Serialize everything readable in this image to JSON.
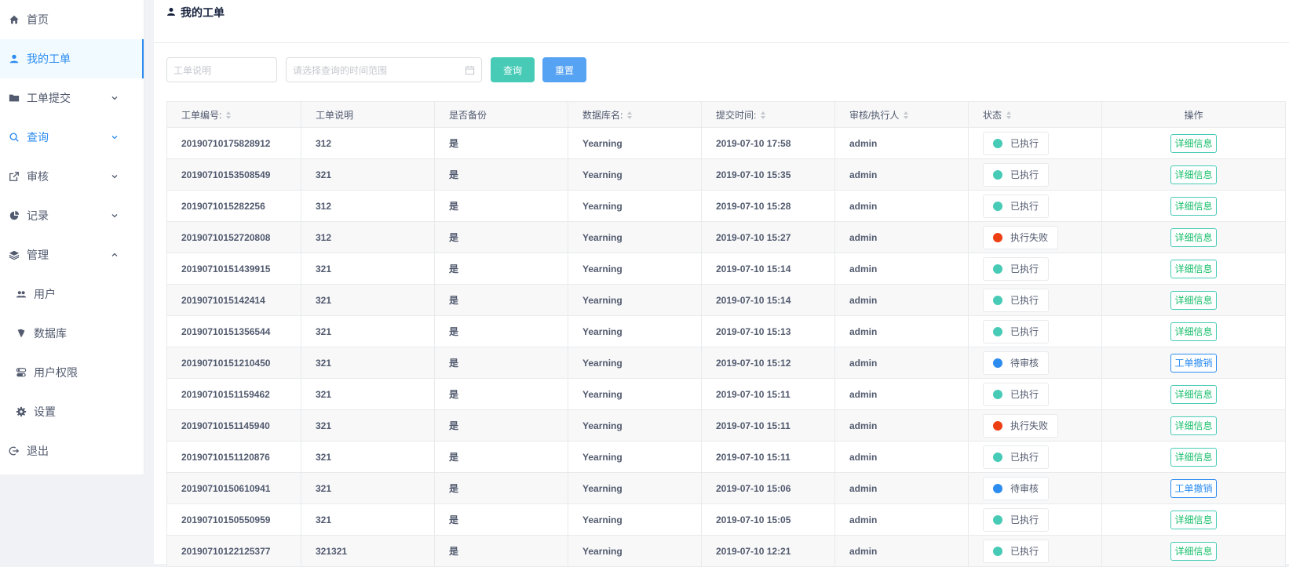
{
  "sidebar": {
    "items": [
      {
        "label": "首页",
        "icon": "home-icon"
      },
      {
        "label": "我的工单",
        "icon": "person-icon"
      },
      {
        "label": "工单提交",
        "icon": "folder-icon"
      },
      {
        "label": "查询",
        "icon": "search-icon"
      },
      {
        "label": "审核",
        "icon": "external-link-icon"
      },
      {
        "label": "记录",
        "icon": "pie-chart-icon"
      },
      {
        "label": "管理",
        "icon": "layers-icon"
      },
      {
        "label": "用户",
        "icon": "people-icon"
      },
      {
        "label": "数据库",
        "icon": "database-icon"
      },
      {
        "label": "用户权限",
        "icon": "toggle-icon"
      },
      {
        "label": "设置",
        "icon": "gear-icon"
      },
      {
        "label": "退出",
        "icon": "logout-icon"
      }
    ]
  },
  "header": {
    "title": "我的工单"
  },
  "toolbar": {
    "desc_placeholder": "工单说明",
    "range_placeholder": "请选择查询的时间范围",
    "query_label": "查询",
    "reset_label": "重置"
  },
  "table": {
    "headers": [
      "工单编号:",
      "工单说明",
      "是否备份",
      "数据库名:",
      "提交时间:",
      "审核/执行人",
      "状态",
      "操作"
    ],
    "rows": [
      {
        "id": "20190710175828912",
        "desc": "312",
        "backup": "是",
        "db": "Yearning",
        "time": "2019-07-10 17:58",
        "user": "admin",
        "status": "已执行",
        "action": "详细信息"
      },
      {
        "id": "20190710153508549",
        "desc": "321",
        "backup": "是",
        "db": "Yearning",
        "time": "2019-07-10 15:35",
        "user": "admin",
        "status": "已执行",
        "action": "详细信息"
      },
      {
        "id": "2019071015282256",
        "desc": "312",
        "backup": "是",
        "db": "Yearning",
        "time": "2019-07-10 15:28",
        "user": "admin",
        "status": "已执行",
        "action": "详细信息"
      },
      {
        "id": "20190710152720808",
        "desc": "312",
        "backup": "是",
        "db": "Yearning",
        "time": "2019-07-10 15:27",
        "user": "admin",
        "status": "执行失败",
        "action": "详细信息"
      },
      {
        "id": "20190710151439915",
        "desc": "321",
        "backup": "是",
        "db": "Yearning",
        "time": "2019-07-10 15:14",
        "user": "admin",
        "status": "已执行",
        "action": "详细信息"
      },
      {
        "id": "2019071015142414",
        "desc": "321",
        "backup": "是",
        "db": "Yearning",
        "time": "2019-07-10 15:14",
        "user": "admin",
        "status": "已执行",
        "action": "详细信息"
      },
      {
        "id": "20190710151356544",
        "desc": "321",
        "backup": "是",
        "db": "Yearning",
        "time": "2019-07-10 15:13",
        "user": "admin",
        "status": "已执行",
        "action": "详细信息"
      },
      {
        "id": "20190710151210450",
        "desc": "321",
        "backup": "是",
        "db": "Yearning",
        "time": "2019-07-10 15:12",
        "user": "admin",
        "status": "待审核",
        "action": "工单撤销"
      },
      {
        "id": "20190710151159462",
        "desc": "321",
        "backup": "是",
        "db": "Yearning",
        "time": "2019-07-10 15:11",
        "user": "admin",
        "status": "已执行",
        "action": "详细信息"
      },
      {
        "id": "20190710151145940",
        "desc": "321",
        "backup": "是",
        "db": "Yearning",
        "time": "2019-07-10 15:11",
        "user": "admin",
        "status": "执行失败",
        "action": "详细信息"
      },
      {
        "id": "20190710151120876",
        "desc": "321",
        "backup": "是",
        "db": "Yearning",
        "time": "2019-07-10 15:11",
        "user": "admin",
        "status": "已执行",
        "action": "详细信息"
      },
      {
        "id": "20190710150610941",
        "desc": "321",
        "backup": "是",
        "db": "Yearning",
        "time": "2019-07-10 15:06",
        "user": "admin",
        "status": "待审核",
        "action": "工单撤销"
      },
      {
        "id": "20190710150550959",
        "desc": "321",
        "backup": "是",
        "db": "Yearning",
        "time": "2019-07-10 15:05",
        "user": "admin",
        "status": "已执行",
        "action": "详细信息"
      },
      {
        "id": "20190710122125377",
        "desc": "321321",
        "backup": "是",
        "db": "Yearning",
        "time": "2019-07-10 12:21",
        "user": "admin",
        "status": "已执行",
        "action": "详细信息"
      }
    ]
  },
  "colors": {
    "accent": "#2d8cf0",
    "executed": "#47cbb6",
    "failed": "#ed3f14",
    "pending": "#2d8cf0"
  }
}
